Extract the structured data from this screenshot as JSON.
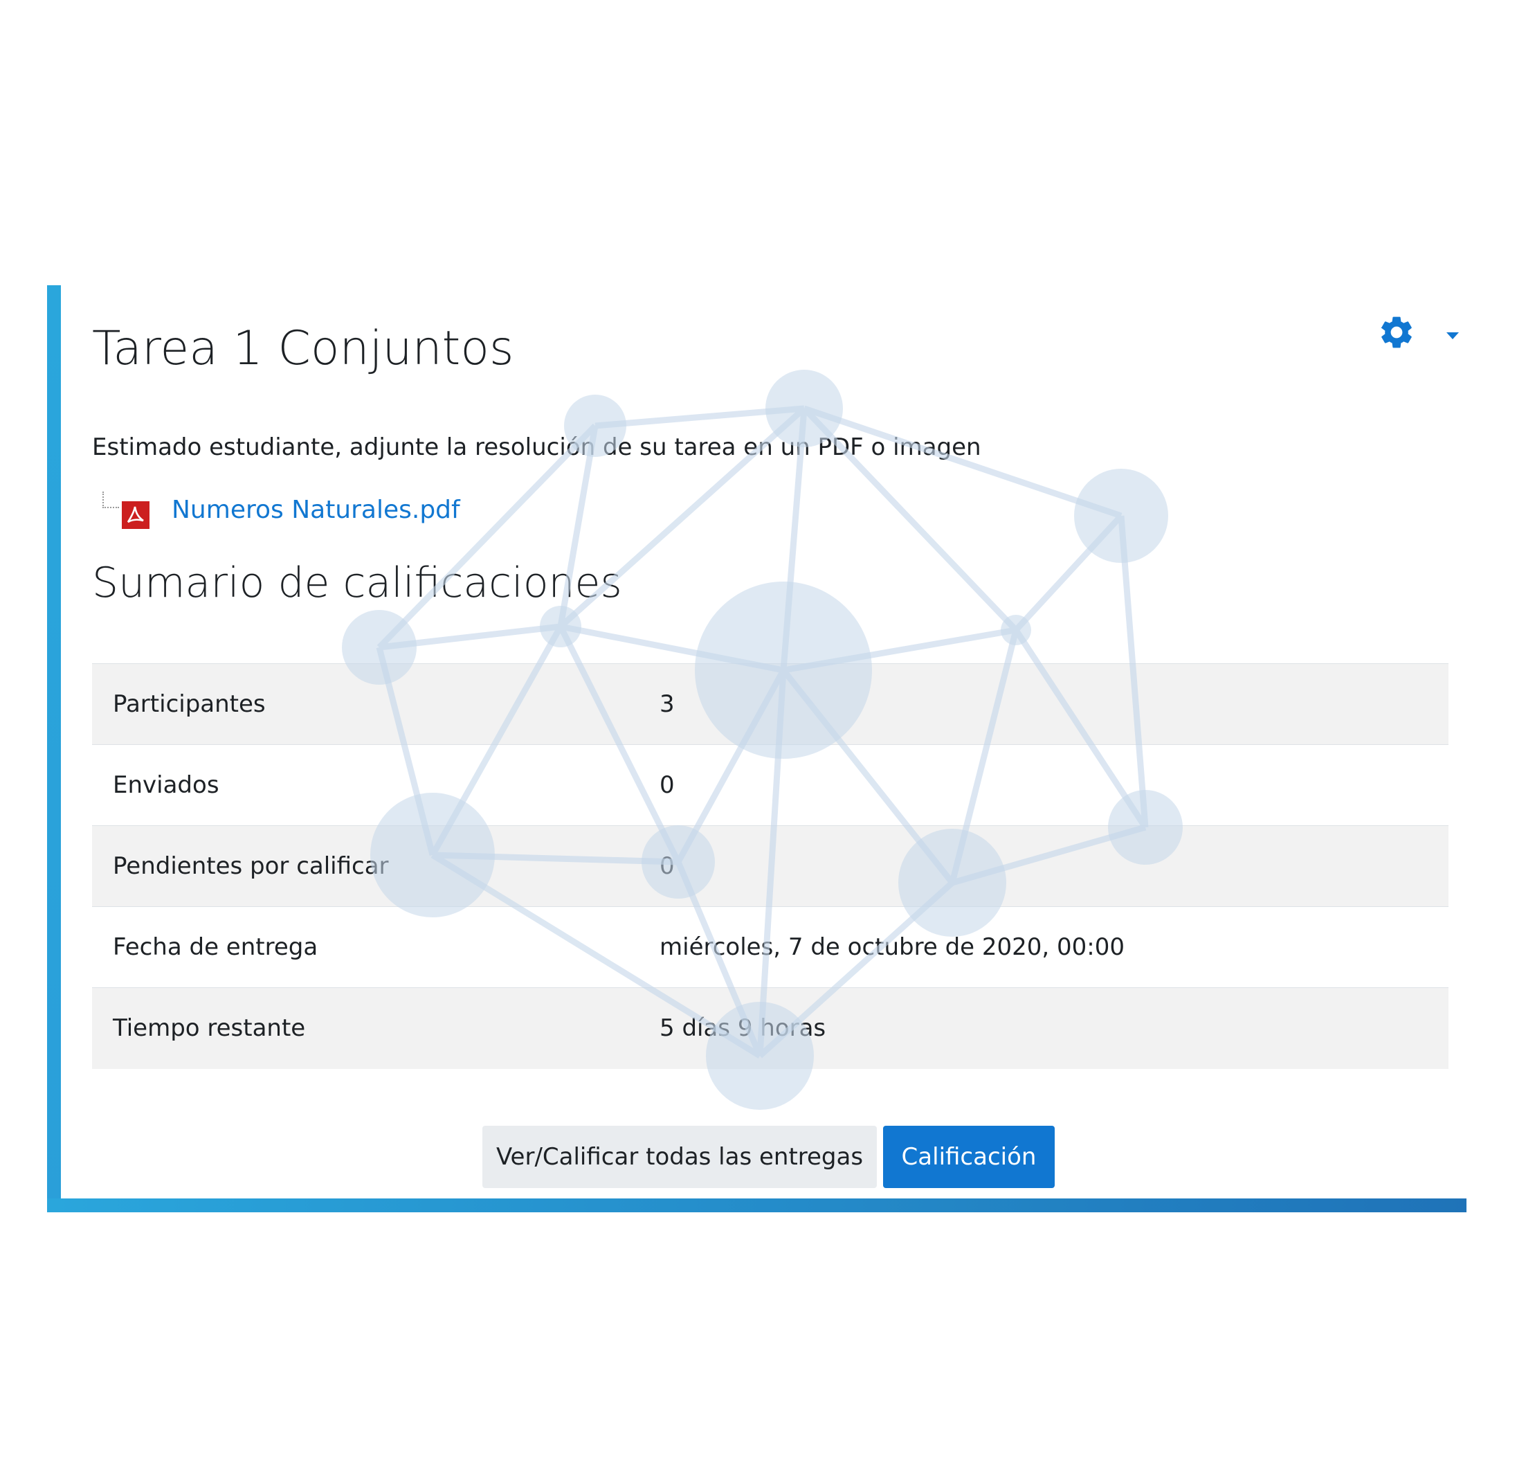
{
  "page": {
    "title": "Tarea 1 Conjuntos",
    "intro": "Estimado estudiante, adjunte la resolución de su tarea en un PDF o imagen"
  },
  "attachment": {
    "filename": "Numeros Naturales.pdf",
    "icon": "pdf-icon"
  },
  "settings_menu": {
    "icon": "gear-icon",
    "caret_icon": "caret-down-icon"
  },
  "summary": {
    "heading": "Sumario de calificaciones",
    "rows": [
      {
        "label": "Participantes",
        "value": "3"
      },
      {
        "label": "Enviados",
        "value": "0"
      },
      {
        "label": "Pendientes por calificar",
        "value": "0"
      },
      {
        "label": "Fecha de entrega",
        "value": "miércoles, 7 de octubre de 2020, 00:00"
      },
      {
        "label": "Tiempo restante",
        "value": "5 días 9 horas"
      }
    ]
  },
  "actions": {
    "view_all_label": "Ver/Calificar todas las entregas",
    "grade_label": "Calificación"
  },
  "colors": {
    "accent": "#1177d1",
    "frame_border": "#2aa6dc",
    "network": "#c5d7ea"
  }
}
